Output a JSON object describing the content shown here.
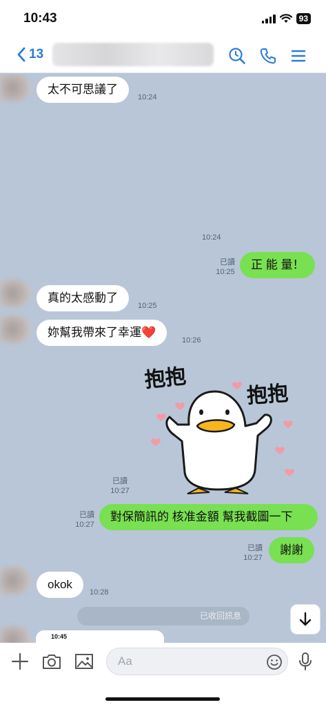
{
  "status_bar": {
    "time": "10:43",
    "battery": "93"
  },
  "header": {
    "back_count": "13"
  },
  "messages": [
    {
      "text": "太不可思議了",
      "time": "10:24"
    },
    {
      "time": "10:24"
    },
    {
      "text": "正 能 量！",
      "read": "已讀",
      "time": "10:25"
    },
    {
      "text": "真的太感動了",
      "time": "10:25"
    },
    {
      "text": "妳幫我帶來了幸運❤️",
      "time": "10:26"
    },
    {
      "read": "已讀",
      "time": "10:27"
    },
    {
      "text": "對保簡訊的 核准金額 幫我截圖一下",
      "read": "已讀",
      "time": "10:27"
    },
    {
      "text": "謝謝",
      "read": "已讀",
      "time": "10:27"
    },
    {
      "text": "okok",
      "time": "10:28"
    }
  ],
  "sticker_text": {
    "left": "抱抱",
    "right": "抱抱"
  },
  "recalled_notice": "已收回訊息",
  "screenshot_preview_time": "10:45",
  "input": {
    "placeholder": "Aa"
  },
  "colors": {
    "accent": "#2a7bd8",
    "outgoing_bubble": "#79e052",
    "chat_background": "#b8c6d8"
  },
  "icons": [
    "chevron-left-icon",
    "search-clock-icon",
    "phone-icon",
    "menu-icon",
    "plus-icon",
    "camera-icon",
    "image-icon",
    "emoji-icon",
    "microphone-icon",
    "arrow-down-icon"
  ]
}
